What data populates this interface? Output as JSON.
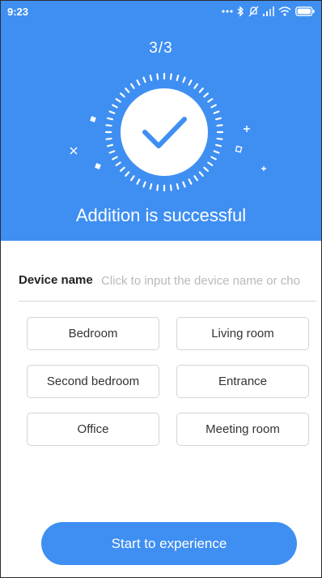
{
  "status_bar": {
    "time": "9:23",
    "icons": [
      "more-dots-icon",
      "bluetooth-icon",
      "mute-icon",
      "signal-icon",
      "wifi-icon",
      "battery-icon"
    ]
  },
  "header": {
    "step": "3/3",
    "result_text": "Addition is successful",
    "badge_icon": "checkmark-icon"
  },
  "device_name": {
    "label": "Device name",
    "value": "",
    "placeholder": "Click to input the device name or cho"
  },
  "room_options": [
    {
      "label": "Bedroom"
    },
    {
      "label": "Living room"
    },
    {
      "label": "Second bedroom"
    },
    {
      "label": "Entrance"
    },
    {
      "label": "Office"
    },
    {
      "label": "Meeting room"
    }
  ],
  "start_button": {
    "label": "Start to experience"
  },
  "colors": {
    "accent": "#3f8ff2",
    "text_primary": "#222222",
    "placeholder": "#b9b9b9",
    "chip_border": "#d4d4d4"
  }
}
